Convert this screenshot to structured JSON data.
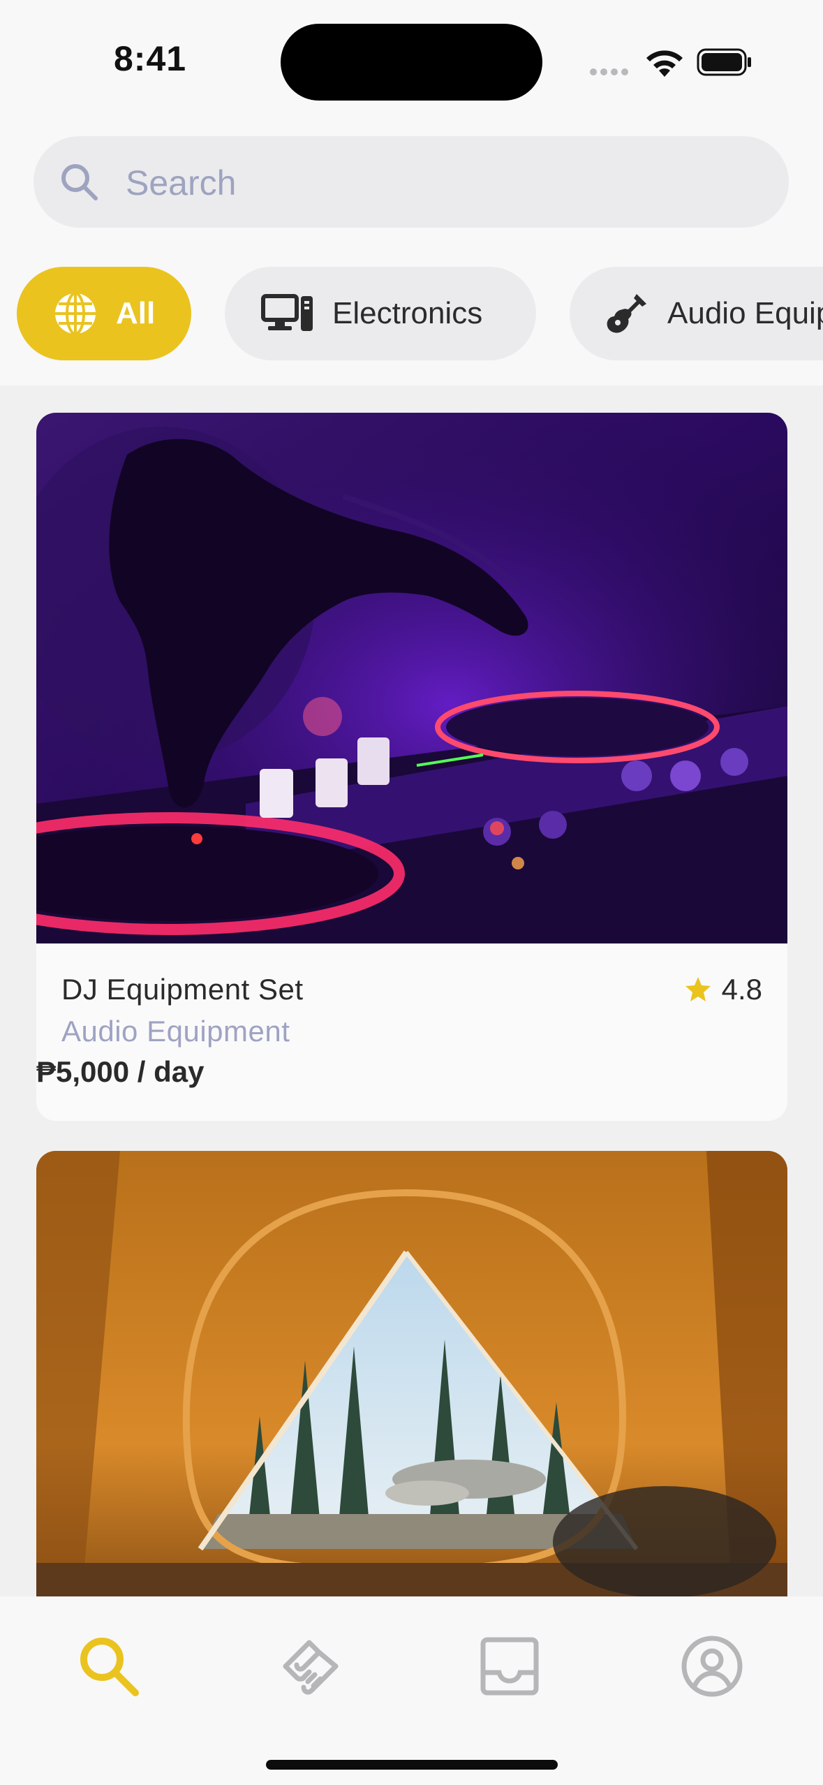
{
  "status_bar": {
    "time": "8:41"
  },
  "search": {
    "placeholder": "Search",
    "value": ""
  },
  "categories": [
    {
      "label": "All",
      "icon": "globe-icon",
      "active": true
    },
    {
      "label": "Electronics",
      "icon": "computer-icon",
      "active": false
    },
    {
      "label": "Audio Equipment",
      "icon": "guitar-icon",
      "active": false
    }
  ],
  "listings": [
    {
      "title": "DJ Equipment Set",
      "category": "Audio Equipment",
      "price": "₱5,000 / day",
      "rating": "4.8",
      "photo": "dj-controller-photo"
    },
    {
      "title": "",
      "photo": "camping-tent-photo"
    }
  ],
  "tabs": [
    {
      "name": "search",
      "icon": "search-icon",
      "active": true
    },
    {
      "name": "rentals",
      "icon": "handshake-icon",
      "active": false
    },
    {
      "name": "inbox",
      "icon": "inbox-icon",
      "active": false
    },
    {
      "name": "profile",
      "icon": "user-circle-icon",
      "active": false
    }
  ],
  "colors": {
    "accent": "#eac31f",
    "muted_text": "#9ea3c4",
    "inactive_icon": "#b6b6b8"
  }
}
